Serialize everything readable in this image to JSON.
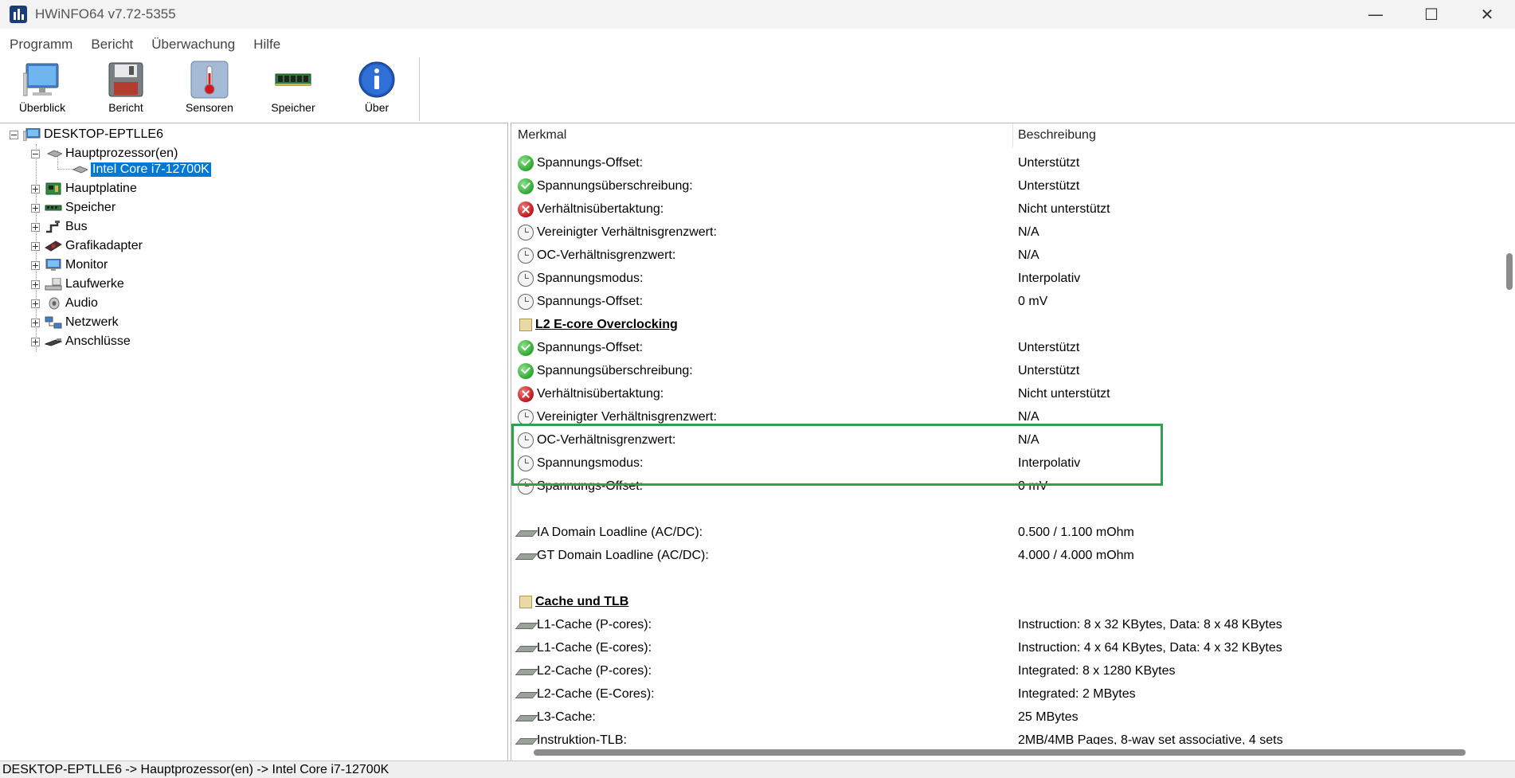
{
  "window": {
    "title": "HWiNFO64 v7.72-5355",
    "minimize_glyph": "—",
    "maximize_glyph": "☐",
    "close_glyph": "✕"
  },
  "menu": [
    "Programm",
    "Bericht",
    "Überwachung",
    "Hilfe"
  ],
  "toolbar": [
    {
      "label": "Überblick",
      "icon": "monitor-icon"
    },
    {
      "label": "Bericht",
      "icon": "floppy-disk-icon"
    },
    {
      "label": "Sensoren",
      "icon": "thermometer-icon"
    },
    {
      "label": "Speicher",
      "icon": "ram-module-icon"
    },
    {
      "label": "Über",
      "icon": "info-icon"
    }
  ],
  "tree": {
    "root": "DESKTOP-EPTLLE6",
    "processor_group": "Hauptprozessor(en)",
    "selected": "Intel Core i7-12700K",
    "items": [
      "Hauptplatine",
      "Speicher",
      "Bus",
      "Grafikadapter",
      "Monitor",
      "Laufwerke",
      "Audio",
      "Netzwerk",
      "Anschlüsse"
    ]
  },
  "table": {
    "col_feature": "Merkmal",
    "col_description": "Beschreibung",
    "rows": [
      {
        "icon": "ok",
        "feature": "Spannungs-Offset:",
        "value": "Unterstützt"
      },
      {
        "icon": "ok",
        "feature": "Spannungsüberschreibung:",
        "value": "Unterstützt"
      },
      {
        "icon": "no",
        "feature": "Verhältnisübertaktung:",
        "value": "Nicht unterstützt"
      },
      {
        "icon": "na",
        "feature": "Vereinigter Verhältnisgrenzwert:",
        "value": "N/A"
      },
      {
        "icon": "na",
        "feature": "OC-Verhältnisgrenzwert:",
        "value": "N/A"
      },
      {
        "icon": "na",
        "feature": "Spannungsmodus:",
        "value": "Interpolativ"
      },
      {
        "icon": "na",
        "feature": "Spannungs-Offset:",
        "value": "0 mV"
      },
      {
        "icon": "stack",
        "feature": "L2 E-core Overclocking",
        "value": "",
        "heading": true
      },
      {
        "icon": "ok",
        "feature": "Spannungs-Offset:",
        "value": "Unterstützt"
      },
      {
        "icon": "ok",
        "feature": "Spannungsüberschreibung:",
        "value": "Unterstützt"
      },
      {
        "icon": "no",
        "feature": "Verhältnisübertaktung:",
        "value": "Nicht unterstützt"
      },
      {
        "icon": "na",
        "feature": "Vereinigter Verhältnisgrenzwert:",
        "value": "N/A"
      },
      {
        "icon": "na",
        "feature": "OC-Verhältnisgrenzwert:",
        "value": "N/A"
      },
      {
        "icon": "na",
        "feature": "Spannungsmodus:",
        "value": "Interpolativ"
      },
      {
        "icon": "na",
        "feature": "Spannungs-Offset:",
        "value": "0 mV"
      },
      {
        "icon": "none",
        "feature": "",
        "value": ""
      },
      {
        "icon": "chip",
        "feature": "IA Domain Loadline (AC/DC):",
        "value": "0.500 / 1.100 mOhm"
      },
      {
        "icon": "chip",
        "feature": "GT Domain Loadline (AC/DC):",
        "value": "4.000 / 4.000 mOhm"
      },
      {
        "icon": "none",
        "feature": "",
        "value": ""
      },
      {
        "icon": "stack",
        "feature": "Cache und TLB",
        "value": "",
        "heading": true
      },
      {
        "icon": "chip",
        "feature": "L1-Cache (P-cores):",
        "value": "Instruction: 8 x 32 KBytes, Data: 8 x 48 KBytes"
      },
      {
        "icon": "chip",
        "feature": "L1-Cache (E-cores):",
        "value": "Instruction: 4 x 64 KBytes, Data: 4 x 32 KBytes"
      },
      {
        "icon": "chip",
        "feature": "L2-Cache (P-cores):",
        "value": "Integrated: 8 x 1280 KBytes"
      },
      {
        "icon": "chip",
        "feature": "L2-Cache (E-Cores):",
        "value": "Integrated: 2 MBytes"
      },
      {
        "icon": "chip",
        "feature": "L3-Cache:",
        "value": "25 MBytes"
      },
      {
        "icon": "chip",
        "feature": "Instruktion-TLB:",
        "value": "2MB/4MB Pages, 8-way set associative, 4 sets"
      }
    ]
  },
  "statusbar": "DESKTOP-EPTLLE6 -> Hauptprozessor(en) -> Intel Core i7-12700K"
}
